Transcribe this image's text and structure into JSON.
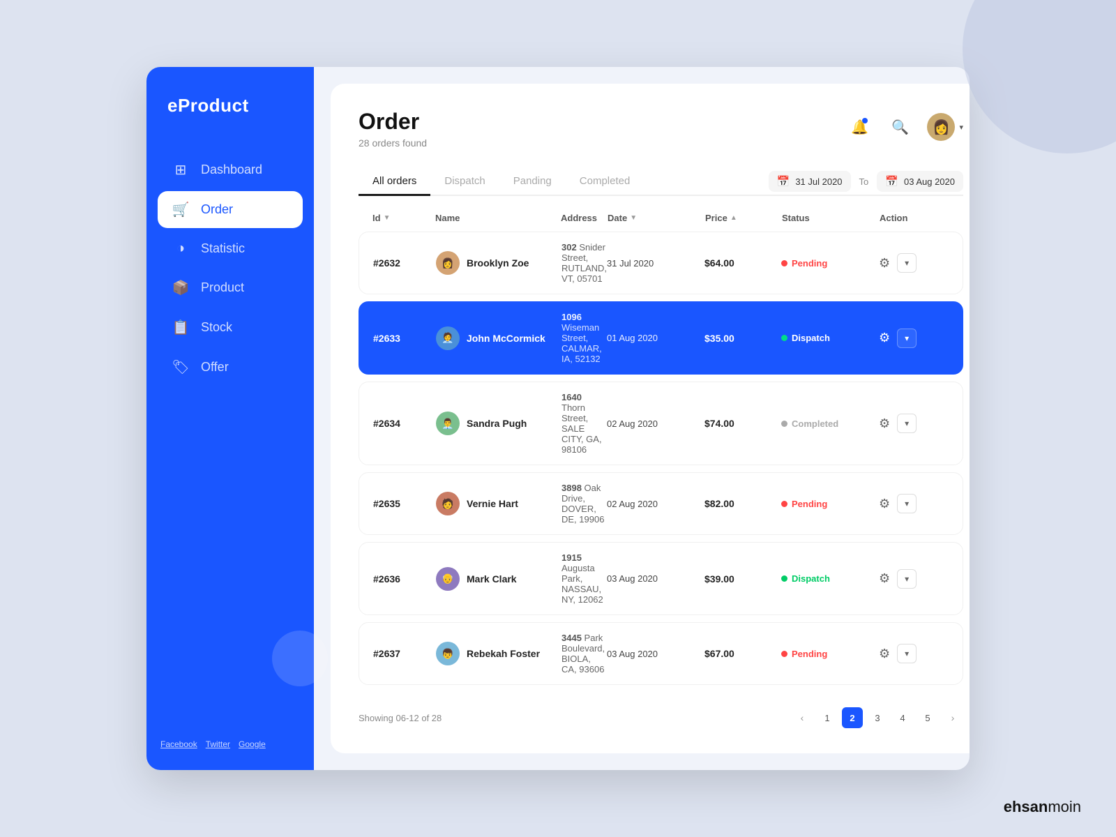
{
  "brand": "eProduct",
  "sidebar": {
    "nav_items": [
      {
        "id": "dashboard",
        "label": "Dashboard",
        "icon": "⊞",
        "active": false
      },
      {
        "id": "order",
        "label": "Order",
        "icon": "🛒",
        "active": true
      },
      {
        "id": "statistic",
        "label": "Statistic",
        "icon": "◑",
        "active": false
      },
      {
        "id": "product",
        "label": "Product",
        "icon": "📦",
        "active": false
      },
      {
        "id": "stock",
        "label": "Stock",
        "icon": "📋",
        "active": false
      },
      {
        "id": "offer",
        "label": "Offer",
        "icon": "🏷",
        "active": false
      }
    ],
    "footer_links": [
      "Facebook",
      "Twitter",
      "Google"
    ]
  },
  "header": {
    "title": "Order",
    "order_count": "28 orders found"
  },
  "tabs": [
    {
      "id": "all",
      "label": "All orders",
      "active": true
    },
    {
      "id": "dispatch",
      "label": "Dispatch",
      "active": false
    },
    {
      "id": "pending",
      "label": "Panding",
      "active": false
    },
    {
      "id": "completed",
      "label": "Completed",
      "active": false
    }
  ],
  "date_range": {
    "from": "31 Jul 2020",
    "to_label": "To",
    "to": "03 Aug 2020"
  },
  "table": {
    "columns": [
      {
        "id": "id",
        "label": "Id",
        "sortable": true
      },
      {
        "id": "name",
        "label": "Name",
        "sortable": false
      },
      {
        "id": "address",
        "label": "Address",
        "sortable": false
      },
      {
        "id": "date",
        "label": "Date",
        "sortable": true
      },
      {
        "id": "price",
        "label": "Price",
        "sortable": true
      },
      {
        "id": "status",
        "label": "Status",
        "sortable": false
      },
      {
        "id": "action",
        "label": "Action",
        "sortable": false
      }
    ],
    "rows": [
      {
        "id": "#2632",
        "name": "Brooklyn Zoe",
        "avatar": "👩",
        "address_num": "302",
        "address_street": "Snider Street,",
        "address_city": "RUTLAND, VT, 05701",
        "date": "31 Jul 2020",
        "price": "$64.00",
        "status": "Pending",
        "status_type": "pending",
        "active": false
      },
      {
        "id": "#2633",
        "name": "John McCormick",
        "avatar": "👨",
        "address_num": "1096",
        "address_street": "Wiseman Street,",
        "address_city": "CALMAR, IA, 52132",
        "date": "01 Aug 2020",
        "price": "$35.00",
        "status": "Dispatch",
        "status_type": "dispatch",
        "active": true
      },
      {
        "id": "#2634",
        "name": "Sandra Pugh",
        "avatar": "👨‍💼",
        "address_num": "1640",
        "address_street": "Thorn Street,",
        "address_city": "SALE CITY, GA, 98106",
        "date": "02 Aug 2020",
        "price": "$74.00",
        "status": "Completed",
        "status_type": "completed",
        "active": false
      },
      {
        "id": "#2635",
        "name": "Vernie Hart",
        "avatar": "🧑",
        "address_num": "3898",
        "address_street": "Oak Drive,",
        "address_city": "DOVER, DE, 19906",
        "date": "02 Aug 2020",
        "price": "$82.00",
        "status": "Pending",
        "status_type": "pending",
        "active": false
      },
      {
        "id": "#2636",
        "name": "Mark Clark",
        "avatar": "👴",
        "address_num": "1915",
        "address_street": "Augusta Park,",
        "address_city": "NASSAU, NY, 12062",
        "date": "03 Aug 2020",
        "price": "$39.00",
        "status": "Dispatch",
        "status_type": "dispatch",
        "active": false
      },
      {
        "id": "#2637",
        "name": "Rebekah Foster",
        "avatar": "👦",
        "address_num": "3445",
        "address_street": "Park Boulevard,",
        "address_city": "BIOLA, CA, 93606",
        "date": "03 Aug 2020",
        "price": "$67.00",
        "status": "Pending",
        "status_type": "pending",
        "active": false
      }
    ]
  },
  "pagination": {
    "showing": "Showing 06-12 of 28",
    "current_page": 2,
    "pages": [
      1,
      2,
      3,
      4,
      5
    ]
  },
  "branding": {
    "bold": "ehsan",
    "light": "moin"
  }
}
